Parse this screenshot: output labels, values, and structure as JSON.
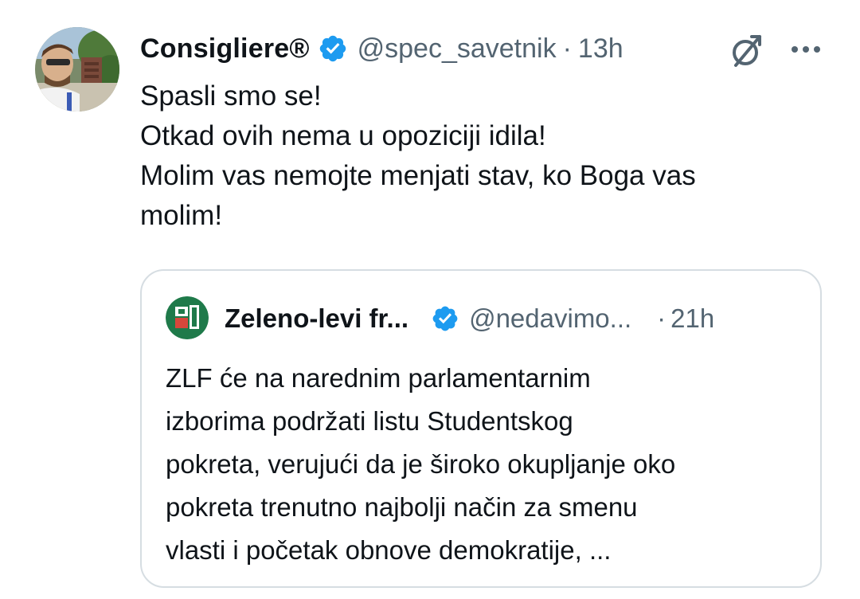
{
  "tweet": {
    "display_name": "Consigliere®",
    "handle": "@spec_savetnik",
    "separator": "·",
    "time": "13h",
    "verified_icon": "verified-badge-icon",
    "grok_icon": "grok-icon",
    "more_icon": "more-options-icon",
    "text_lines": [
      "Spasli smo se!",
      "Otkad ovih nema u opoziciji idila!",
      "Molim vas nemojte menjati stav, ko Boga vas",
      "molim!"
    ]
  },
  "quote": {
    "display_name": "Zeleno-levi fr...",
    "handle": "@nedavimo...",
    "separator": "·",
    "time": "21h",
    "verified_icon": "verified-badge-icon",
    "text_lines": [
      "ZLF će na narednim parlamentarnim",
      "izborima podržati listu Studentskog",
      "pokreta, verujući da je široko okupljanje oko",
      "pokreta trenutno najbolji način za smenu",
      "vlasti i početak obnove demokratije, ..."
    ]
  },
  "colors": {
    "verified_blue": "#1d9bf0",
    "secondary_text": "#536471",
    "primary_text": "#0f1419",
    "border": "#d6dde2",
    "zlf_green": "#1f7a4a",
    "zlf_red": "#d8473b"
  }
}
